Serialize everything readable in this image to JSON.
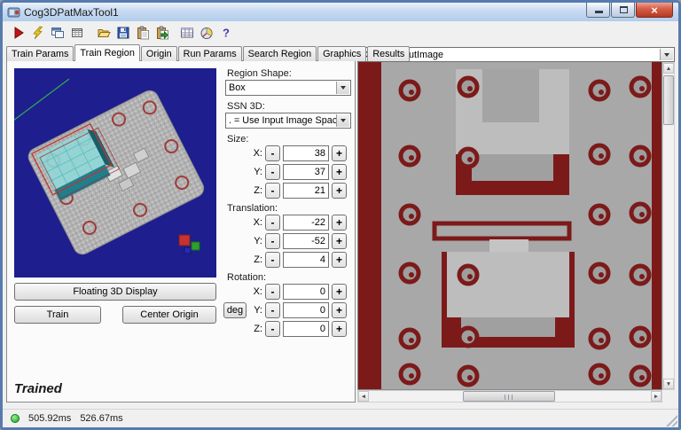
{
  "window": {
    "title": "Cog3DPatMaxTool1",
    "close_glyph": "×",
    "controls": [
      "minimize",
      "maximize",
      "close"
    ]
  },
  "toolbar": {
    "help_glyph": "?",
    "icons": [
      "run-icon",
      "live-run-icon",
      "floating-window-icon",
      "grid-window-icon",
      "open-icon",
      "save-icon",
      "paste-icon",
      "import-icon",
      "results-table-icon",
      "measure-icon",
      "help-icon"
    ]
  },
  "tabs": [
    {
      "label": "Train Params",
      "active": false
    },
    {
      "label": "Train Region",
      "active": true
    },
    {
      "label": "Origin",
      "active": false
    },
    {
      "label": "Run Params",
      "active": false
    },
    {
      "label": "Search Region",
      "active": false
    },
    {
      "label": "Graphics",
      "active": false
    },
    {
      "label": "Results",
      "active": false
    }
  ],
  "left_panel": {
    "floating_display_button": "Floating 3D Display",
    "train_button": "Train",
    "center_origin_button": "Center Origin",
    "trained_status": "Trained"
  },
  "form": {
    "region_shape_label": "Region Shape:",
    "region_shape_value": "Box",
    "ssn3d_label": "SSN 3D:",
    "ssn3d_value": ". = Use Input Image Space",
    "minus": "-",
    "plus": "+",
    "size": {
      "label": "Size:",
      "rows": [
        {
          "axis": "X:",
          "value": "38"
        },
        {
          "axis": "Y:",
          "value": "37"
        },
        {
          "axis": "Z:",
          "value": "21"
        }
      ]
    },
    "translation": {
      "label": "Translation:",
      "rows": [
        {
          "axis": "X:",
          "value": "-22"
        },
        {
          "axis": "Y:",
          "value": "-52"
        },
        {
          "axis": "Z:",
          "value": "4"
        }
      ]
    },
    "rotation": {
      "label": "Rotation:",
      "deg_button": "deg",
      "rows": [
        {
          "axis": "X:",
          "value": "0"
        },
        {
          "axis": "Y:",
          "value": "0"
        },
        {
          "axis": "Z:",
          "value": "0"
        }
      ]
    }
  },
  "image_panel": {
    "source_selector": "Current.InputImage"
  },
  "scroll": {
    "up": "▲",
    "down": "▼",
    "left": "◄",
    "right": "►"
  },
  "status_bar": {
    "time_1": "505.92ms",
    "time_2": "526.67ms"
  },
  "colors": {
    "status_green": "#2db52d",
    "viewport_background": "#1e1e8e",
    "image_background": "#a8a8a8",
    "image_foreground": "#7c1a1a",
    "train_region_box": "#8fd8d8"
  }
}
